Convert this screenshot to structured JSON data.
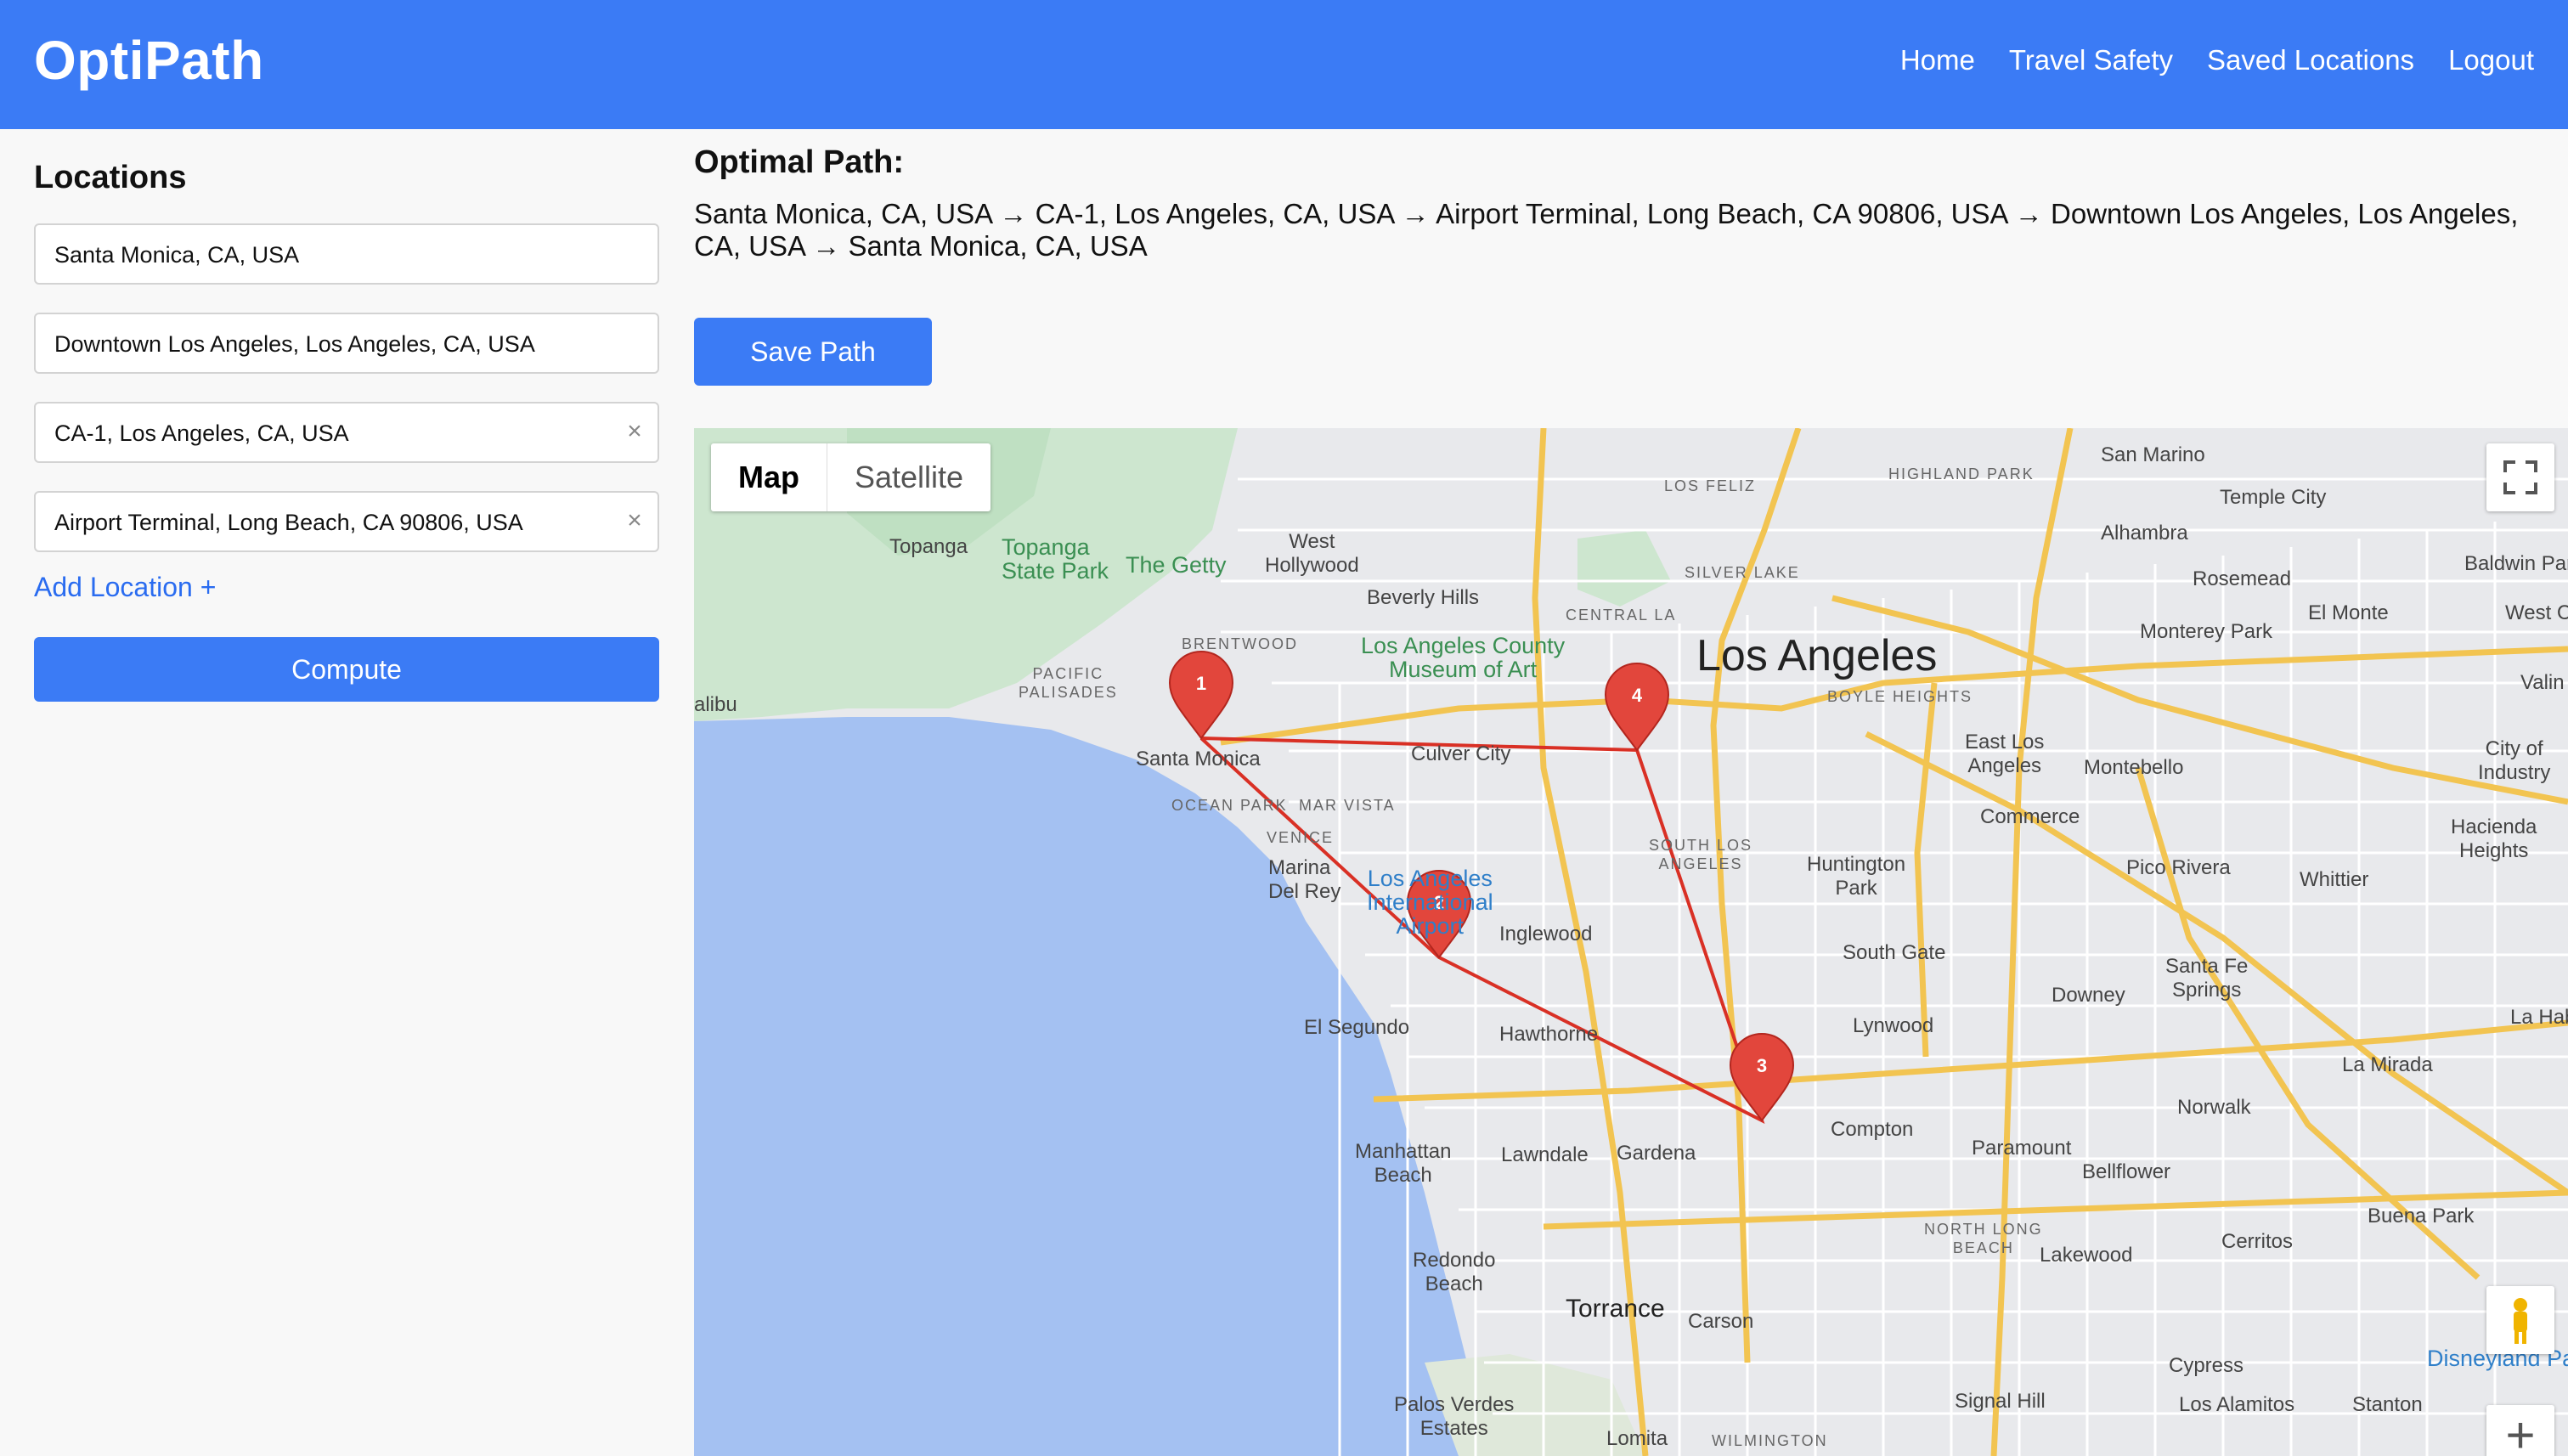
{
  "app": {
    "title": "OptiPath"
  },
  "nav": [
    "Home",
    "Travel Safety",
    "Saved Locations",
    "Logout"
  ],
  "sidebar": {
    "heading": "Locations",
    "locations": [
      "Santa Monica, CA, USA",
      "Downtown Los Angeles, Los Angeles, CA, USA",
      "CA-1, Los Angeles, CA, USA",
      "Airport Terminal, Long Beach, CA 90806, USA"
    ],
    "clear_icon": "×",
    "add_location": "Add Location +",
    "compute": "Compute"
  },
  "result": {
    "heading": "Optimal Path:",
    "path": "Santa Monica, CA, USA → CA-1, Los Angeles, CA, USA → Airport Terminal, Long Beach, CA 90806, USA → Downtown Los Angeles, Los Angeles, CA, USA → Santa Monica, CA, USA",
    "save": "Save Path"
  },
  "map": {
    "type_map": "Map",
    "type_satellite": "Satellite",
    "zoom_in": "+",
    "markers": [
      "1",
      "2",
      "3",
      "4"
    ],
    "route_color": "#d93025",
    "labels": {
      "los_angeles": "Los Angeles",
      "santa_monica": "Santa Monica",
      "torrance": "Torrance",
      "topanga": "Topanga",
      "topanga_park": "Topanga\nState Park",
      "getty": "The Getty",
      "west_hollywood": "West\nHollywood",
      "beverly_hills": "Beverly Hills",
      "lacma": "Los Angeles County\nMuseum of Art",
      "culver_city": "Culver City",
      "marina": "Marina\nDel Rey",
      "lax": "Los Angeles\nInternational\nAirport",
      "inglewood": "Inglewood",
      "el_segundo": "El Segundo",
      "hawthorne": "Hawthorne",
      "manhattan": "Manhattan\nBeach",
      "lawndale": "Lawndale",
      "gardena": "Gardena",
      "redondo": "Redondo\nBeach",
      "carson": "Carson",
      "palos_verdes": "Palos Verdes\nEstates",
      "lomita": "Lomita",
      "compton": "Compton",
      "lynwood": "Lynwood",
      "south_gate": "South Gate",
      "huntington_park": "Huntington\nPark",
      "commerce": "Commerce",
      "east_la": "East Los\nAngeles",
      "montebello": "Montebello",
      "monterey_park": "Monterey Park",
      "alhambra": "Alhambra",
      "san_marino": "San Marino",
      "temple_city": "Temple City",
      "rosemead": "Rosemead",
      "el_monte": "El Monte",
      "baldwin_park": "Baldwin Park",
      "west_covina": "West C",
      "valinda": "Valin",
      "city_industry": "City of\nIndustry",
      "hacienda": "Hacienda\nHeights",
      "pico_rivera": "Pico Rivera",
      "whittier": "Whittier",
      "downey": "Downey",
      "santa_fe_springs": "Santa Fe\nSprings",
      "la_habra": "La Hab",
      "la_mirada": "La Mirada",
      "norwalk": "Norwalk",
      "paramount": "Paramount",
      "bellflower": "Bellflower",
      "buena_park": "Buena Park",
      "cerritos": "Cerritos",
      "lakewood": "Lakewood",
      "cypress": "Cypress",
      "disneyland": "Disneyland Pa",
      "los_alamitos": "Los Alamitos",
      "stanton": "Stanton",
      "signal_hill": "Signal Hill",
      "malibu": "alibu",
      "brentwood": "BRENTWOOD",
      "pacific_palisades": "PACIFIC\nPALISADES",
      "los_feliz": "LOS FELIZ",
      "highland_park": "HIGHLAND PARK",
      "silver_lake": "SILVER LAKE",
      "central_la": "CENTRAL LA",
      "boyle_heights": "BOYLE HEIGHTS",
      "ocean_park": "OCEAN PARK",
      "mar_vista": "MAR VISTA",
      "venice": "VENICE",
      "south_la": "SOUTH LOS\nANGELES",
      "north_long_beach": "NORTH LONG\nBEACH",
      "wilmington": "WILMINGTON"
    }
  }
}
